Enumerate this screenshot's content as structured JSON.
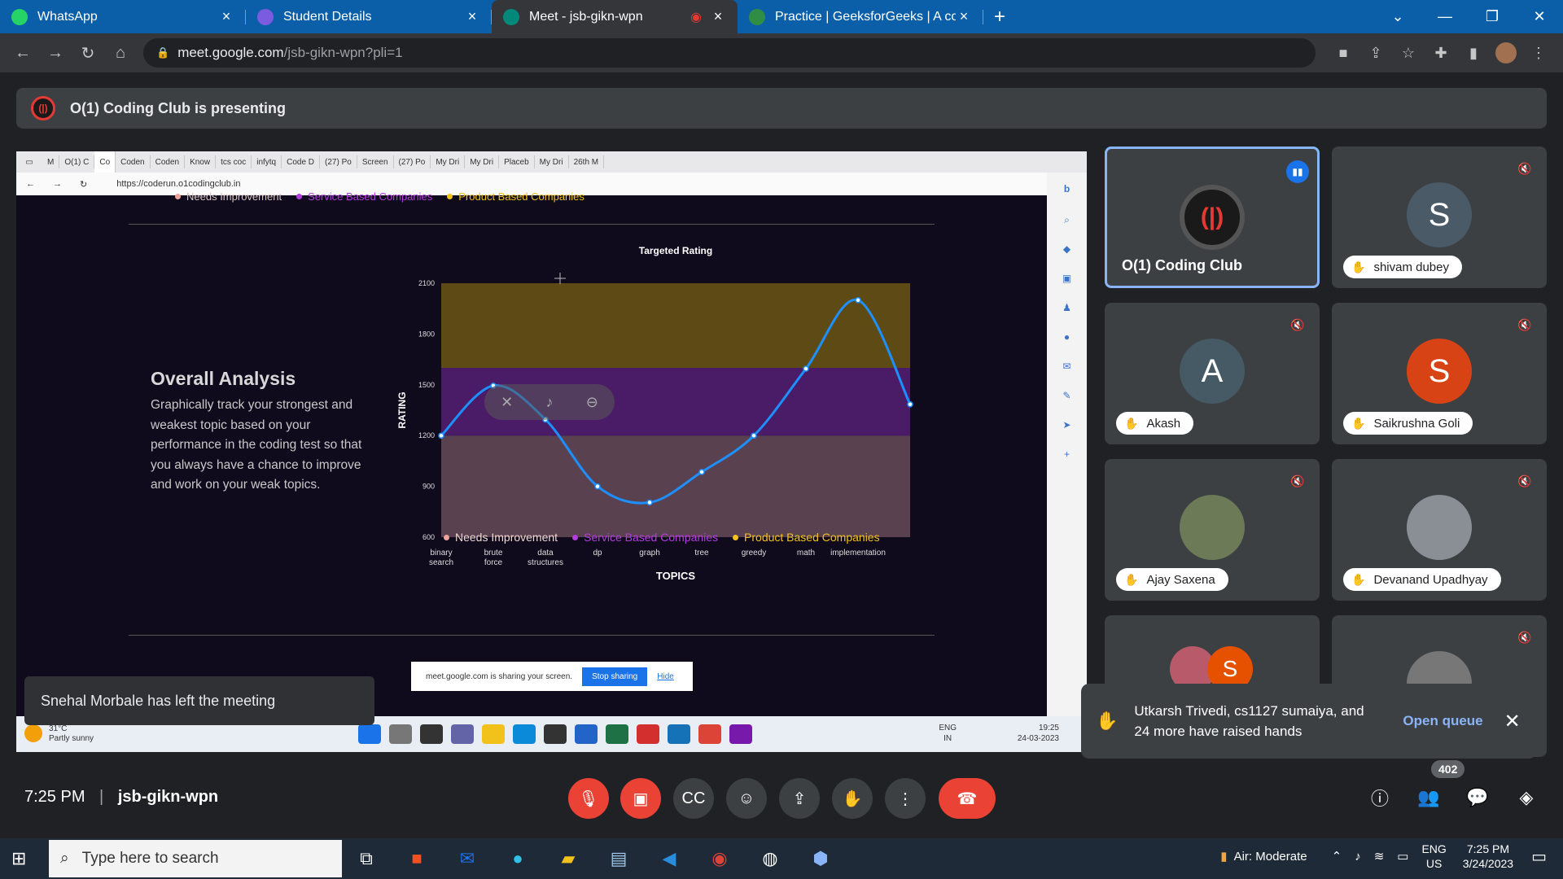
{
  "browser": {
    "tabs": [
      {
        "title": "WhatsApp",
        "fav_color": "#25d366",
        "fav_icon": "whatsapp-icon",
        "active": false
      },
      {
        "title": "Student Details",
        "fav_color": "#7b5ce0",
        "fav_icon": "forms-icon",
        "active": false
      },
      {
        "title": "Meet - jsb-gikn-wpn",
        "fav_color": "#00897b",
        "fav_icon": "meet-icon",
        "active": true
      },
      {
        "title": "Practice | GeeksforGeeks | A com",
        "fav_color": "#2f8d46",
        "fav_icon": "gfg-icon",
        "active": false
      }
    ],
    "url_host": "meet.google.com",
    "url_path": "/jsb-gikn-wpn?pli=1"
  },
  "meet": {
    "presenting_text": "O(1) Coding Club is presenting",
    "meeting_time": "7:25 PM",
    "meeting_code": "jsb-gikn-wpn",
    "participants_count": "402",
    "left_toast": "Snehal Morbale has left the meeting",
    "hands_toast": "Utkarsh Trivedi, cs1127 sumaiya, and 24 more have raised hands",
    "hands_link": "Open queue"
  },
  "participants": [
    {
      "name": "O(1) Coding Club",
      "initial": "",
      "color": "#1a1a1a"
    },
    {
      "name": "shivam dubey",
      "initial": "S",
      "color": "#4a5a66"
    },
    {
      "name": "Akash",
      "initial": "A",
      "color": "#455a64"
    },
    {
      "name": "Saikrushna Goli",
      "initial": "S",
      "color": "#d84315"
    },
    {
      "name": "Ajay Saxena",
      "initial": "",
      "color": "#6d7a58"
    },
    {
      "name": "Devanand Upadhyay",
      "initial": "",
      "color": "#8a8f95"
    },
    {
      "name": "",
      "initial": "S",
      "color": "#e65100"
    },
    {
      "name": "",
      "initial": "",
      "color": "#777"
    }
  ],
  "shared": {
    "inner_tabs": [
      "M",
      "O(1) C",
      "Co",
      "Coden",
      "Coden",
      "Know",
      "tcs coc",
      "infytq",
      "Code D",
      "(27) Po",
      "Screen",
      "(27) Po",
      "My Dri",
      "My Dri",
      "Placeb",
      "My Dri",
      "26th M"
    ],
    "inner_url": "https://coderun.o1codingclub.in",
    "analysis_title": "Overall Analysis",
    "analysis_body": "Graphically track your strongest and weakest topic based on your performance in the coding test so that you always have a chance to improve and work on your weak topics.",
    "share_banner": "meet.google.com is sharing your screen.",
    "stop_sharing": "Stop sharing",
    "hide": "Hide",
    "weather_temp": "31°C",
    "weather_desc": "Partly sunny",
    "inner_lang": "ENG",
    "inner_region": "IN",
    "inner_time": "19:25",
    "inner_date": "24-03-2023"
  },
  "chart_data": {
    "type": "line",
    "title": "Targeted Rating",
    "xlabel": "TOPICS",
    "ylabel": "RATING",
    "categories": [
      "binary search",
      "brute force",
      "data structures",
      "dp",
      "graph",
      "tree",
      "greedy",
      "math",
      "implementation"
    ],
    "values": [
      1200,
      1495,
      1295,
      900,
      805,
      985,
      1200,
      1595,
      2000,
      1385
    ],
    "ylim": [
      600,
      2100
    ],
    "yticks": [
      600,
      900,
      1200,
      1500,
      1800,
      2100
    ],
    "bands": [
      {
        "name": "Needs Improvement",
        "from": 600,
        "to": 1200,
        "color": "#5a4150"
      },
      {
        "name": "Service Based Companies",
        "from": 1200,
        "to": 1600,
        "color": "#4a1b66"
      },
      {
        "name": "Product Based Companies",
        "from": 1600,
        "to": 2100,
        "color": "#5e4a14"
      }
    ],
    "legend_colors": [
      "#f0a39a",
      "#b43de0",
      "#f2c21b"
    ],
    "line_color": "#1e8fff"
  },
  "os": {
    "search_placeholder": "Type here to search",
    "air": "Air: Moderate",
    "lang": "ENG",
    "region": "US",
    "time": "7:25 PM",
    "date": "3/24/2023"
  }
}
